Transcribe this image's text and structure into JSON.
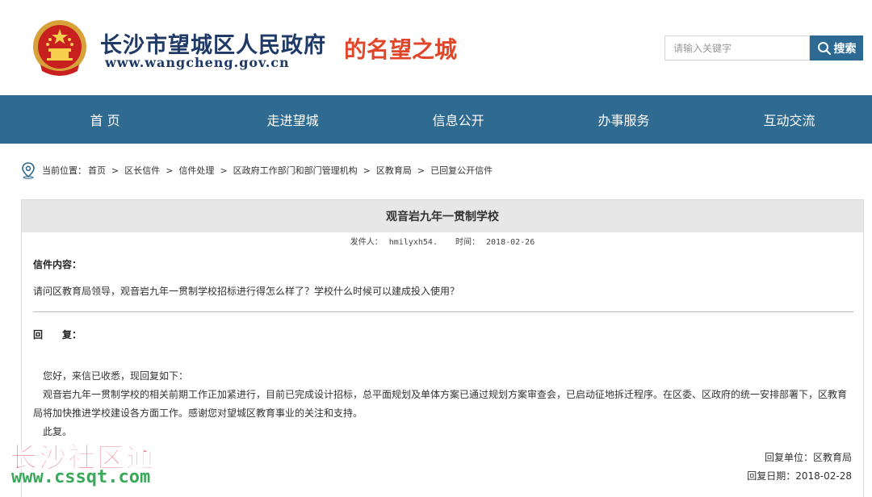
{
  "header": {
    "site_name_cn": "长沙市望城区人民政府",
    "site_name_en": "www.wangcheng.gov.cn",
    "slogan": "的名望之城",
    "search": {
      "placeholder": "请输入关键字",
      "button_label": "搜索"
    }
  },
  "nav": {
    "items": [
      {
        "label": "首 页"
      },
      {
        "label": "走进望城"
      },
      {
        "label": "信息公开"
      },
      {
        "label": "办事服务"
      },
      {
        "label": "互动交流"
      }
    ]
  },
  "breadcrumb": {
    "label": "当前位置：",
    "items": [
      "首页",
      "区长信件",
      "信件处理",
      "区政府工作部门和部门管理机构",
      "区教育局",
      "已回复公开信件"
    ],
    "separator": ">"
  },
  "letter": {
    "title": "观音岩九年一贯制学校",
    "sender_label": "发件人：",
    "sender": "hmilyxh54.",
    "time_label": "时间：",
    "time": "2018-02-26",
    "content_label": "信件内容：",
    "content": "请问区教育局领导，观音岩九年一贯制学校招标进行得怎么样了？学校什么时候可以建成投入使用？",
    "reply_label": "回　　复：",
    "reply_greeting": "您好，来信已收悉，现回复如下：",
    "reply_body": "观音岩九年一贯制学校的相关前期工作正加紧进行，目前已完成设计招标，总平面规划及单体方案已通过规划方案审查会，已启动征地拆迁程序。在区委、区政府的统一安排部署下，区教育局将加快推进学校建设各方面工作。感谢您对望城区教育事业的关注和支持。",
    "reply_closing": "此复。",
    "reply_unit": "回复单位：区教育局",
    "reply_date": "回复日期：2018-02-28"
  },
  "watermark": {
    "name": "长沙社区通",
    "url": "www.cssqt.com"
  },
  "colors": {
    "nav_bg": "#2f6a90",
    "search_button_bg": "#2c6a93",
    "slogan": "#e0462a",
    "logo_text": "#1f3a66",
    "title_bar_bg": "#e7e7e7"
  }
}
